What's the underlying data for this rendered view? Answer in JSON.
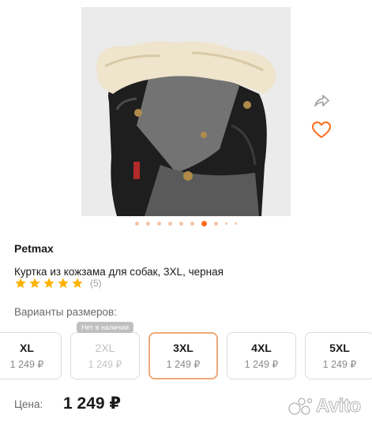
{
  "gallery": {
    "dots_total": 10,
    "active_index": 6
  },
  "actions": {
    "share_icon": "share-icon",
    "favorite_icon": "heart-icon",
    "accent_color": "#ff6b1a"
  },
  "product": {
    "brand": "Petmax",
    "title": "Куртка из кожзама для собак, 3XL, черная",
    "rating": 5,
    "stars_count": 5,
    "reviews": "(5)",
    "star_color": "#ffb300"
  },
  "sizes": {
    "label": "Варианты размеров:",
    "items": [
      {
        "name": "XL",
        "price": "1 249 ₽",
        "available": true,
        "selected": false
      },
      {
        "name": "2XL",
        "price": "1 249 ₽",
        "available": false,
        "selected": false,
        "badge": "Нет в наличии"
      },
      {
        "name": "3XL",
        "price": "1 249 ₽",
        "available": true,
        "selected": true
      },
      {
        "name": "4XL",
        "price": "1 249 ₽",
        "available": true,
        "selected": false
      },
      {
        "name": "5XL",
        "price": "1 249 ₽",
        "available": true,
        "selected": false
      }
    ]
  },
  "price": {
    "label": "Цена:",
    "value": "1 249 ₽"
  },
  "watermark": {
    "text": "Avito"
  }
}
